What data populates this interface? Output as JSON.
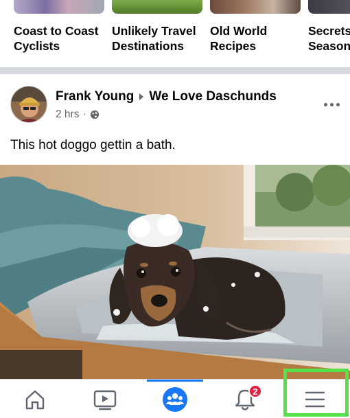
{
  "carousel": {
    "cards": [
      {
        "title_line1": "Coast to Coast",
        "title_line2": "Cyclists"
      },
      {
        "title_line1": "Unlikely Travel",
        "title_line2": "Destinations"
      },
      {
        "title_line1": "Old World",
        "title_line2": "Recipes"
      },
      {
        "title_line1": "Secrets",
        "title_line2": "Season"
      }
    ]
  },
  "post": {
    "author": "Frank Young",
    "group": "We Love Daschunds",
    "time": "2 hrs",
    "separator": "·",
    "privacy_icon": "globe-icon",
    "text": "This hot doggo gettin a bath.",
    "photo_subject": "dachshund-in-sink"
  },
  "tabbar": {
    "tabs": [
      {
        "name": "home",
        "icon": "home-icon"
      },
      {
        "name": "watch",
        "icon": "video-icon"
      },
      {
        "name": "groups",
        "icon": "groups-icon",
        "active": true
      },
      {
        "name": "notifications",
        "icon": "bell-icon",
        "badge": "2"
      },
      {
        "name": "menu",
        "icon": "menu-icon",
        "highlighted": true
      }
    ]
  },
  "colors": {
    "accent": "#1877f2",
    "badge": "#e41e3f",
    "highlight": "#56e04a",
    "secondary_text": "#65676b"
  }
}
